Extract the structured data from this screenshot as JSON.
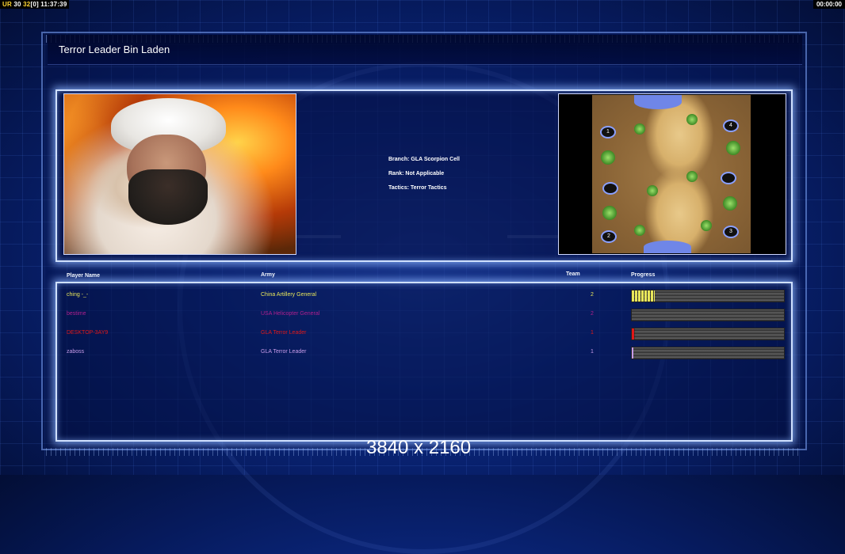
{
  "hud": {
    "ur_label": "UR",
    "fps_a": "30",
    "fps_b": "32",
    "bracket_value": "[0]",
    "clock": "11:37:39",
    "timer": "00:00:00"
  },
  "title": "Terror Leader Bin Laden",
  "general_info": {
    "branch": "Branch: GLA Scorpion Cell",
    "rank": "Rank: Not Applicable",
    "tactics": "Tactics: Terror Tactics"
  },
  "map": {
    "spawns": [
      "1",
      "4",
      "2",
      "3"
    ]
  },
  "roster": {
    "headers": {
      "player": "Player Name",
      "army": "Army",
      "team": "Team",
      "progress": "Progress"
    },
    "players": [
      {
        "name": "ching -_-",
        "army": "China Artillery General",
        "team": "2",
        "color": "#e8e65a",
        "progress": 0.15
      },
      {
        "name": "bestime",
        "army": "USA Helicopter General",
        "team": "2",
        "color": "#b0208e",
        "progress": 0.0
      },
      {
        "name": "DESKTOP-3AY9",
        "army": "GLA Terror Leader",
        "team": "1",
        "color": "#e01818",
        "progress": 0.02
      },
      {
        "name": "zaboss",
        "army": "GLA Terror Leader",
        "team": "1",
        "color": "#c79be8",
        "progress": 0.01
      }
    ]
  },
  "watermark": "3840 x 2160"
}
